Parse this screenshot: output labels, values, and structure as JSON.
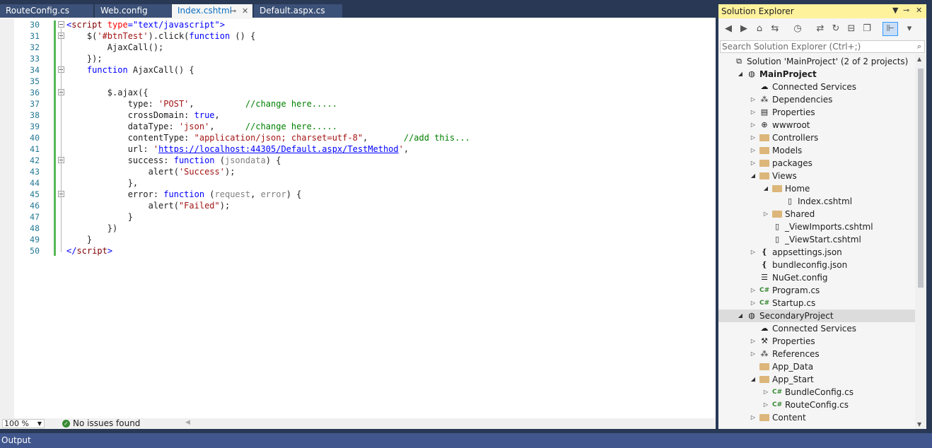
{
  "tabs": [
    {
      "label": "RouteConfig.cs",
      "active": false
    },
    {
      "label": "Web.config",
      "active": false
    },
    {
      "label": "Index.cshtml",
      "active": true
    },
    {
      "label": "Default.aspx.cs",
      "active": false
    }
  ],
  "tab_controls": {
    "pin": "⊸",
    "close": "✕"
  },
  "editor": {
    "line_numbers": [
      "30",
      "31",
      "32",
      "33",
      "34",
      "35",
      "36",
      "37",
      "38",
      "39",
      "40",
      "41",
      "42",
      "43",
      "44",
      "45",
      "46",
      "47",
      "48",
      "49",
      "50"
    ]
  },
  "code": {
    "l30": {
      "open": "<",
      "tag": "script",
      "attr": " type",
      "eq": "=",
      "val": "\"text/javascript\"",
      "close": ">"
    },
    "l31": {
      "a": "    $(",
      "str": "'#btnTest'",
      "b": ").click(",
      "kw": "function",
      "c": " () {"
    },
    "l32": {
      "text": "        AjaxCall();"
    },
    "l33": {
      "text": "    });"
    },
    "l34": {
      "kw": "    function",
      "text": " AjaxCall() {"
    },
    "l35": {
      "text": ""
    },
    "l36": {
      "text": "        $.ajax({"
    },
    "l37": {
      "a": "            type: ",
      "str": "'POST'",
      "b": ",          ",
      "cm": "//change here....."
    },
    "l38": {
      "a": "            crossDomain: ",
      "kw": "true",
      "b": ","
    },
    "l39": {
      "a": "            dataType: ",
      "str": "'json'",
      "b": ",      ",
      "cm": "//change here....."
    },
    "l40": {
      "a": "            contentType: ",
      "str": "\"application/json; charset=utf-8\"",
      "b": ",       ",
      "cm": "//add this..."
    },
    "l41": {
      "a": "            url: ",
      "q1": "'",
      "url": "https://localhost:44305/Default.aspx/TestMethod",
      "q2": "'",
      "b": ","
    },
    "l42": {
      "a": "            success: ",
      "kw": "function",
      "b": " (",
      "gray": "jsondata",
      "c": ") {"
    },
    "l43": {
      "a": "                alert(",
      "str": "'Success'",
      "b": ");"
    },
    "l44": {
      "text": "            },"
    },
    "l45": {
      "a": "            error: ",
      "kw": "function",
      "b": " (",
      "g1": "request",
      "c": ", ",
      "g2": "error",
      "d": ") {"
    },
    "l46": {
      "a": "                alert(",
      "str": "\"Failed\"",
      "b": ");"
    },
    "l47": {
      "text": "            }"
    },
    "l48": {
      "text": "        })"
    },
    "l49": {
      "text": "    }"
    },
    "l50": {
      "open": "</",
      "tag": "script",
      "close": ">"
    }
  },
  "statusbar": {
    "zoom": "100 %",
    "zoom_dropdown": "▼",
    "issues_icon": "✓",
    "issues": "No issues found",
    "scroll_left": "◀"
  },
  "output": {
    "label": "Output"
  },
  "solution_explorer": {
    "title": "Solution Explorer",
    "title_buttons": {
      "dropdown": "▼",
      "pin": "⊸",
      "close": "✕"
    },
    "search_placeholder": "Search Solution Explorer (Ctrl+;)",
    "search_icon": "⌕",
    "toolbar_icons": [
      "back-icon",
      "forward-icon",
      "home-icon",
      "switch-views-icon",
      "pending-changes-icon",
      "sync-icon",
      "refresh-icon",
      "collapse-all-icon",
      "show-all-files-icon",
      "properties-icon",
      "preview-icon"
    ],
    "tree": [
      {
        "label": "Solution 'MainProject' (2 of 2 projects)",
        "icon": "solution-icon",
        "level": 0,
        "arrow": ""
      },
      {
        "label": "MainProject",
        "icon": "web-project-icon",
        "level": 1,
        "arrow": "◢",
        "bold": true
      },
      {
        "label": "Connected Services",
        "icon": "connected-services-icon",
        "level": 2,
        "arrow": ""
      },
      {
        "label": "Dependencies",
        "icon": "dependencies-icon",
        "level": 2,
        "arrow": "▷"
      },
      {
        "label": "Properties",
        "icon": "properties-icon",
        "level": 2,
        "arrow": "▷"
      },
      {
        "label": "wwwroot",
        "icon": "globe-icon",
        "level": 2,
        "arrow": "▷"
      },
      {
        "label": "Controllers",
        "icon": "folder-icon",
        "level": 2,
        "arrow": "▷"
      },
      {
        "label": "Models",
        "icon": "folder-icon",
        "level": 2,
        "arrow": "▷"
      },
      {
        "label": "packages",
        "icon": "folder-icon",
        "level": 2,
        "arrow": "▷"
      },
      {
        "label": "Views",
        "icon": "folder-open-icon",
        "level": 2,
        "arrow": "◢"
      },
      {
        "label": "Home",
        "icon": "folder-open-icon",
        "level": 3,
        "arrow": "◢"
      },
      {
        "label": "Index.cshtml",
        "icon": "file-icon",
        "level": 4,
        "arrow": ""
      },
      {
        "label": "Shared",
        "icon": "folder-icon",
        "level": 3,
        "arrow": "▷"
      },
      {
        "label": "_ViewImports.cshtml",
        "icon": "file-icon",
        "level": 3,
        "arrow": ""
      },
      {
        "label": "_ViewStart.cshtml",
        "icon": "file-icon",
        "level": 3,
        "arrow": ""
      },
      {
        "label": "appsettings.json",
        "icon": "json-file-icon",
        "level": 2,
        "arrow": "▷"
      },
      {
        "label": "bundleconfig.json",
        "icon": "json-file-icon",
        "level": 2,
        "arrow": ""
      },
      {
        "label": "NuGet.config",
        "icon": "config-file-icon",
        "level": 2,
        "arrow": ""
      },
      {
        "label": "Program.cs",
        "icon": "csharp-file-icon",
        "level": 2,
        "arrow": "▷"
      },
      {
        "label": "Startup.cs",
        "icon": "csharp-file-icon",
        "level": 2,
        "arrow": "▷"
      },
      {
        "label": "SecondaryProject",
        "icon": "web-project-icon",
        "level": 1,
        "arrow": "◢",
        "selected": true
      },
      {
        "label": "Connected Services",
        "icon": "connected-services-icon",
        "level": 2,
        "arrow": ""
      },
      {
        "label": "Properties",
        "icon": "wrench-icon",
        "level": 2,
        "arrow": "▷"
      },
      {
        "label": "References",
        "icon": "references-icon",
        "level": 2,
        "arrow": "▷"
      },
      {
        "label": "App_Data",
        "icon": "folder-icon",
        "level": 2,
        "arrow": ""
      },
      {
        "label": "App_Start",
        "icon": "folder-open-icon",
        "level": 2,
        "arrow": "◢"
      },
      {
        "label": "BundleConfig.cs",
        "icon": "csharp-file-icon",
        "level": 3,
        "arrow": "▷"
      },
      {
        "label": "RouteConfig.cs",
        "icon": "csharp-file-icon",
        "level": 3,
        "arrow": "▷"
      },
      {
        "label": "Content",
        "icon": "folder-icon",
        "level": 2,
        "arrow": "▷"
      }
    ],
    "icon_glyphs": {
      "solution-icon": "⧉",
      "web-project-icon": "◍",
      "connected-services-icon": "☁",
      "dependencies-icon": "⁂",
      "properties-icon": "▤",
      "globe-icon": "⊕",
      "folder-icon": "",
      "folder-open-icon": "",
      "file-icon": "▯",
      "json-file-icon": "❴",
      "config-file-icon": "☰",
      "csharp-file-icon": "C#",
      "wrench-icon": "⚒",
      "references-icon": "⁂"
    },
    "colors": {
      "title_bg": "#fff29d",
      "selected_row": "#dcdcdc",
      "folder": "#dcb67a",
      "csharp": "#388a34"
    }
  },
  "colors": {
    "frame": "#293955",
    "active_tab_text": "#0e70c0",
    "change_bar": "#57b757",
    "line_number": "#237893",
    "keyword": "#0000ff",
    "string": "#a31515",
    "comment": "#008000",
    "tag": "#800000",
    "attr": "#ff0000"
  }
}
